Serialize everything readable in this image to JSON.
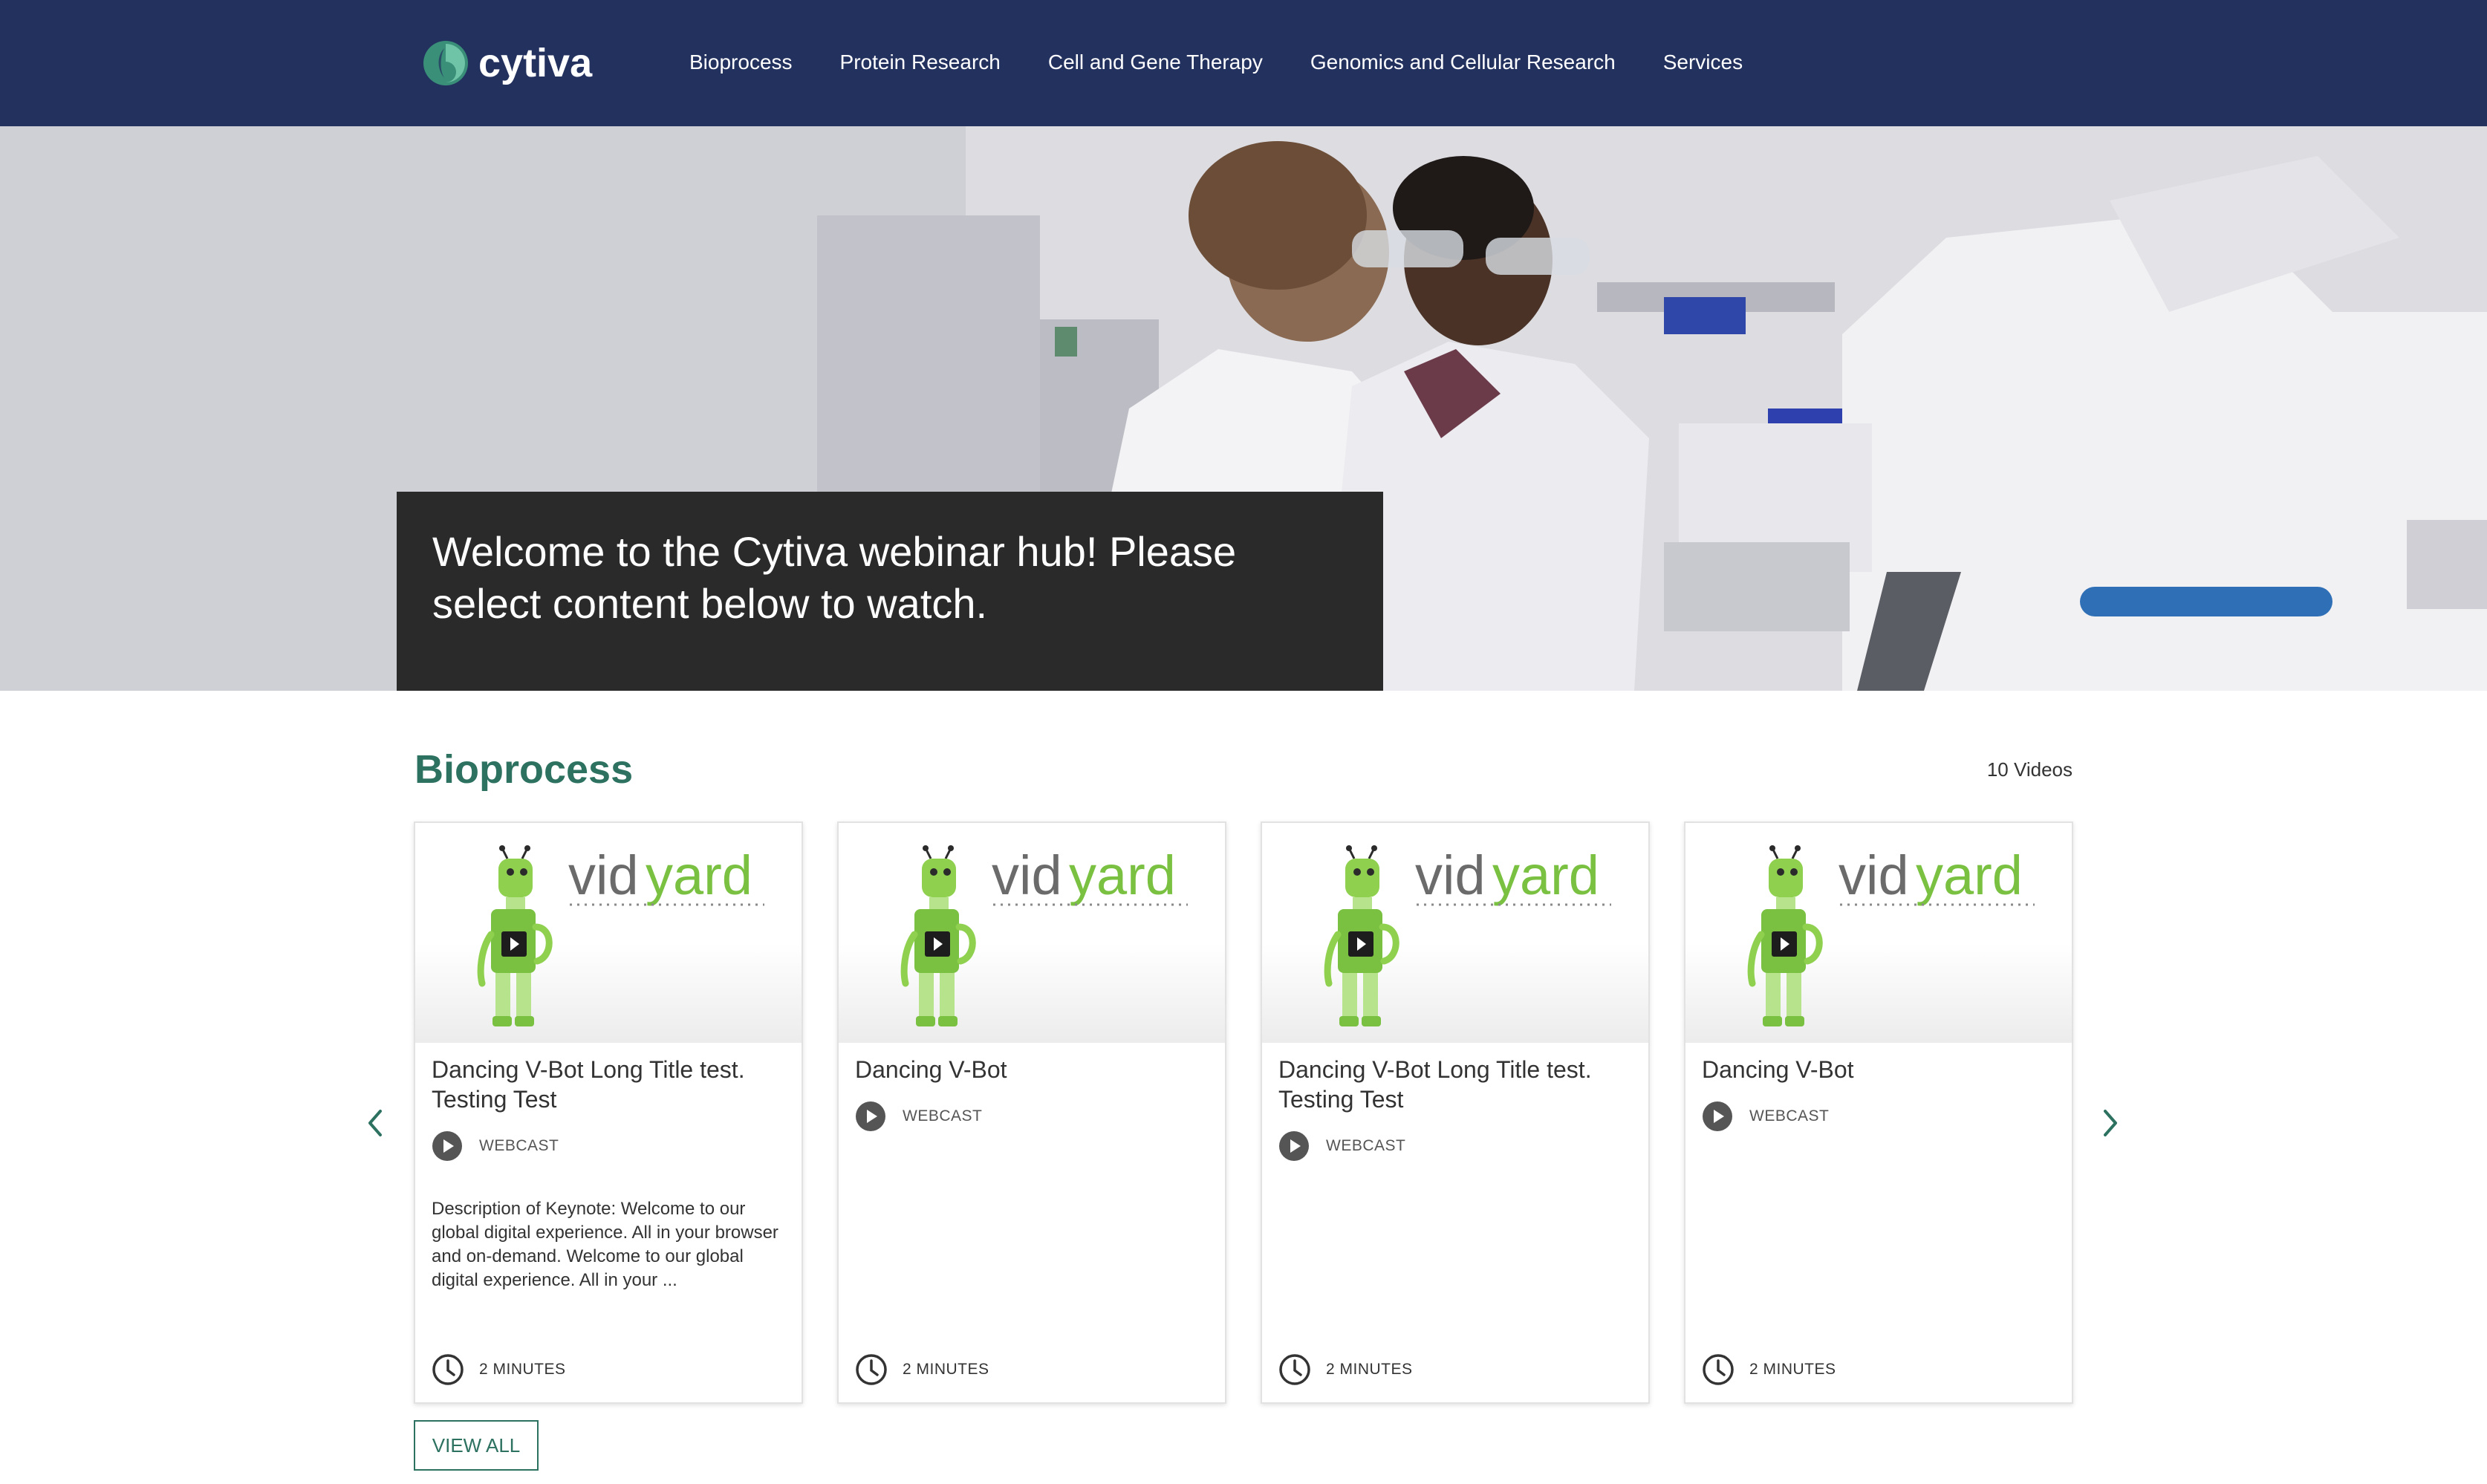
{
  "header": {
    "logo_text": "cytiva",
    "nav": [
      {
        "label": "Bioprocess"
      },
      {
        "label": "Protein Research"
      },
      {
        "label": "Cell and Gene Therapy"
      },
      {
        "label": "Genomics and Cellular Research"
      },
      {
        "label": "Services"
      }
    ]
  },
  "hero": {
    "caption": "Welcome to the Cytiva webinar hub! Please select content below to watch."
  },
  "section": {
    "title": "Bioprocess",
    "count": "10 Videos",
    "view_all": "VIEW ALL"
  },
  "cards": [
    {
      "title": "Dancing V-Bot Long Title test. Testing Test",
      "type": "WEBCAST",
      "description": "Description of Keynote: Welcome to our global digital experience. All in your browser and on-demand. Welcome to our global digital experience. All in your ...",
      "duration": "2 MINUTES",
      "thumbnail_brand": "vidyard"
    },
    {
      "title": "Dancing V-Bot",
      "type": "WEBCAST",
      "description": "",
      "duration": "2 MINUTES",
      "thumbnail_brand": "vidyard"
    },
    {
      "title": "Dancing V-Bot Long Title test. Testing Test",
      "type": "WEBCAST",
      "description": "",
      "duration": "2 MINUTES",
      "thumbnail_brand": "vidyard"
    },
    {
      "title": "Dancing V-Bot",
      "type": "WEBCAST",
      "description": "",
      "duration": "2 MINUTES",
      "thumbnail_brand": "vidyard"
    }
  ],
  "colors": {
    "header_bg": "#23315f",
    "accent_green": "#2d7160",
    "caption_bg": "#2a2a2a",
    "vidyard_green": "#7ac142"
  },
  "icons": [
    "cytiva-logo-icon",
    "play-icon",
    "clock-icon",
    "chevron-left-icon",
    "chevron-right-icon"
  ]
}
